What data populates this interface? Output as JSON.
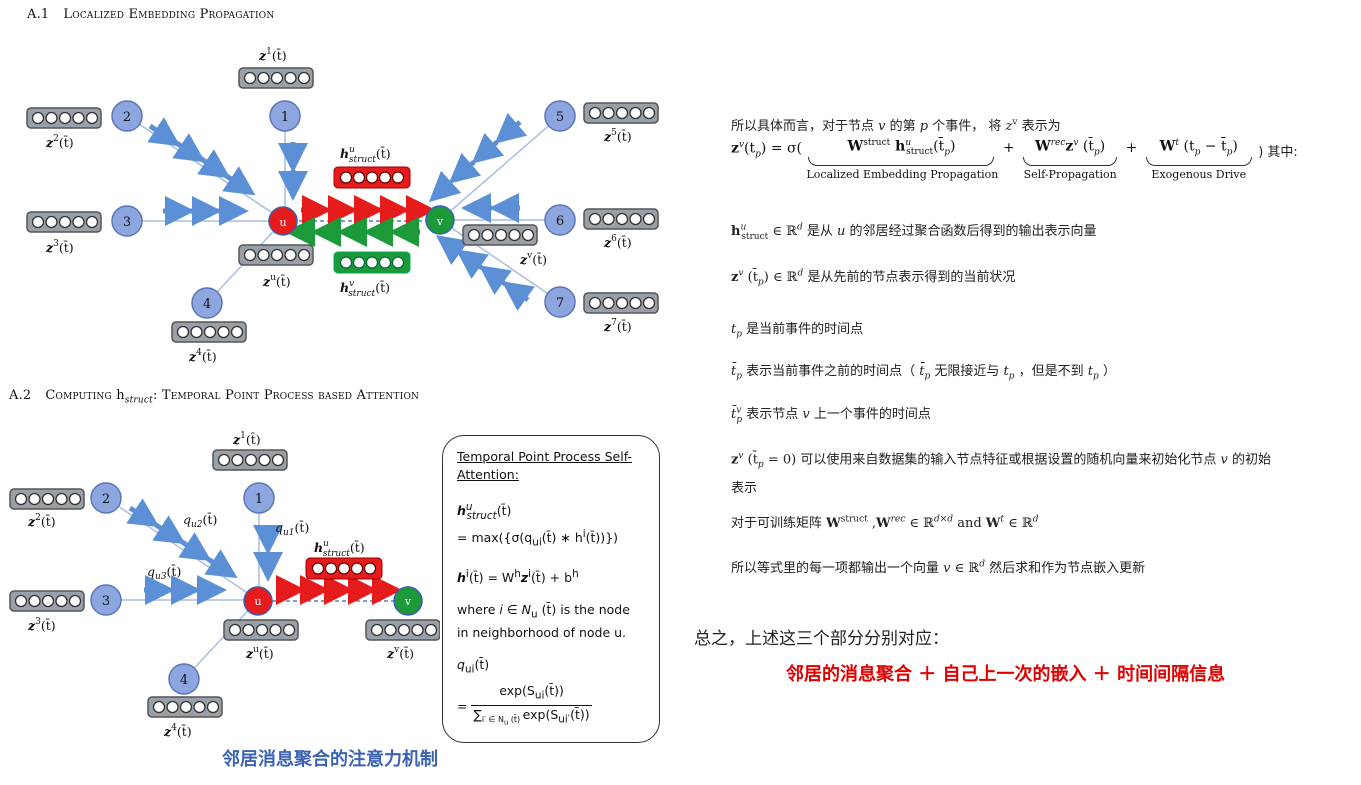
{
  "section_a1": {
    "number": "A.1",
    "title": "Localized Embedding Propagation"
  },
  "section_a2": {
    "number": "A.2",
    "title_pre": "Computing ",
    "title_h": "h",
    "title_sub": "struct",
    "title_post": ": Temporal Point Process based Attention"
  },
  "fig1": {
    "nodes": [
      "1",
      "2",
      "3",
      "4",
      "5",
      "6",
      "7",
      "u",
      "v"
    ],
    "labels": {
      "z1": "z",
      "z1_sup": "1",
      "z2_sup": "2",
      "z3_sup": "3",
      "z4_sup": "4",
      "z5_sup": "5",
      "z6_sup": "6",
      "z7_sup": "7",
      "zu_sup": "u",
      "zv_sup": "v",
      "t_arg": "(t̄)",
      "h_u": "h",
      "h_u_sup": "u",
      "h_sub": "struct",
      "h_v_sup": "v"
    }
  },
  "fig2": {
    "q_labels": [
      "q",
      "u2",
      "u1",
      "u3"
    ],
    "t_arg": "(t̄)"
  },
  "attention_box": {
    "title": "Temporal Point Process Self-Attention:",
    "line1": "h",
    "line1_sup": "u",
    "line1_sub": "struct",
    "line1_arg": "(t̄)",
    "line2": "= max({σ(q",
    "line2_sub": "ui",
    "line2_mid": "(t̄) ∗ h",
    "line2_sup": "i",
    "line2_end": "(t̄))})",
    "line3_a": "h",
    "line3_sup": "i",
    "line3_b": "(t̄) = W",
    "line3_sup2": "h",
    "line3_c": "z",
    "line3_sup3": "i",
    "line3_d": "(t̄) + b",
    "line3_sup4": "h",
    "where_a": "where ",
    "where_i": "i ∈ N",
    "where_sub": "u",
    "where_b": " (t̄) is the node in neighborhood of node u.",
    "q_a": "q",
    "q_sub": "ui",
    "q_arg": "(t̄)",
    "q_eq": "=",
    "q_num": "exp(S",
    "q_num_sub": "ui",
    "q_num_end": "(t̄))",
    "q_den": "∑",
    "q_den_sub": "i′ ∈ N",
    "q_den_sub2": "u",
    "q_den_mid": " (t̄) ",
    "q_den_b": "exp(S",
    "q_den_sub3": "ui′",
    "q_den_end": "(t̄))"
  },
  "caption_left": "邻居消息聚合的注意力机制",
  "right": {
    "intro_a": "所以具体而言，对于节点 ",
    "intro_v": "v",
    "intro_b": " 的第 ",
    "intro_p": "p",
    "intro_c": " 个事件， 将 ",
    "intro_z": "z",
    "intro_zsup": "v",
    "intro_d": " 表示为",
    "eq_lhs": "z",
    "eq_lhs_sup": "v",
    "eq_lhs_arg": "(t",
    "eq_lhs_sub": "p",
    "eq_sigma": ") = σ(",
    "term1": "W",
    "term1_sup": "struct",
    "term1_h": " h",
    "term1_hsup": "u",
    "term1_hsub": "struct",
    "term1_arg": "(t̄",
    "term1_argsub": "p",
    "term1_close": ")",
    "term1_label": "Localized Embedding Propagation",
    "plus": "+",
    "term2": "W",
    "term2_sup": "rec",
    "term2_z": "z",
    "term2_zsup": "v",
    "term2_arg": " (t̄",
    "term2_argsup": "v",
    "term2_argsub": "p",
    "term2_close": ")",
    "term2_label": "Self-Propagation",
    "term3": "W",
    "term3_sup": "t",
    "term3_arg": " (t",
    "term3_argsub": "p",
    "term3_minus": " − t̄",
    "term3_argsup": "v",
    "term3_argsub2": "p",
    "term3_close": ")",
    "term3_label": "Exogenous Drive",
    "eq_end": ") 其中:",
    "l1_a": "h",
    "l1_sup": "u",
    "l1_sub": "struct",
    "l1_b": " ∈ ℝ",
    "l1_dsup": "d",
    "l1_c": " 是从 ",
    "l1_u": "u",
    "l1_d": " 的邻居经过聚合函数后得到的输出表示向量",
    "l2_a": "z",
    "l2_sup": "v",
    "l2_arg": " (t̄",
    "l2_argsup": "v",
    "l2_argsub": "p",
    "l2_b": ") ∈ ℝ",
    "l2_dsup": "d",
    "l2_c": " 是从先前的节点表示得到的当前状况",
    "l3_a": "t",
    "l3_sub": "p",
    "l3_b": " 是当前事件的时间点",
    "l4_a": "t̄",
    "l4_sub": "p",
    "l4_b": " 表示当前事件之前的时间点（ ",
    "l4_c": "t̄",
    "l4_csub": "p",
    "l4_d": " 无限接近与 ",
    "l4_e": "t",
    "l4_esub": "p",
    "l4_f": " ，但是不到 ",
    "l4_g": "t",
    "l4_gsub": "p",
    "l4_h": " ）",
    "l5_a": "t̄",
    "l5_sup": "v",
    "l5_sub": "p",
    "l5_b": " 表示节点 ",
    "l5_v": "v",
    "l5_c": " 上一个事件的时间点",
    "l6_a": "z",
    "l6_sup": "v",
    "l6_arg": " (t̄",
    "l6_argsup": "v",
    "l6_argsub": "p",
    "l6_b": " = 0)",
    "l6_c": " 可以使用来自数据集的输入节点特征或根据设置的随机向量来初始化节点 ",
    "l6_v": "v",
    "l6_d": " 的初始",
    "l6_e": "表示",
    "l7_a": "对于可训练矩阵 ",
    "l7_w1": "W",
    "l7_w1sup": "struct",
    "l7_b": " ,",
    "l7_w2": "W",
    "l7_w2sup": "rec",
    "l7_c": " ∈ ℝ",
    "l7_csup": "d×d",
    "l7_d": " and ",
    "l7_w3": "W",
    "l7_w3sup": "t",
    "l7_e": " ∈ ℝ",
    "l7_esup": "d",
    "l8_a": "所以等式里的每一项都输出一个向量 ",
    "l8_v": "v",
    "l8_b": " ∈ ℝ",
    "l8_bsup": "d",
    "l8_c": " 然后求和作为节点嵌入更新"
  },
  "summary": "总之，上述这三个部分分别对应：",
  "summary_red": "邻居的消息聚合 ＋ 自己上一次的嵌入 ＋ 时间间隔信息",
  "colors": {
    "node_fill": "#8ea6e0",
    "u_node": "#e61b1b",
    "v_node": "#1c9a3a",
    "arrow_blue": "#5b8fd6",
    "red": "#e00000",
    "caption_blue": "#3b63b5"
  }
}
